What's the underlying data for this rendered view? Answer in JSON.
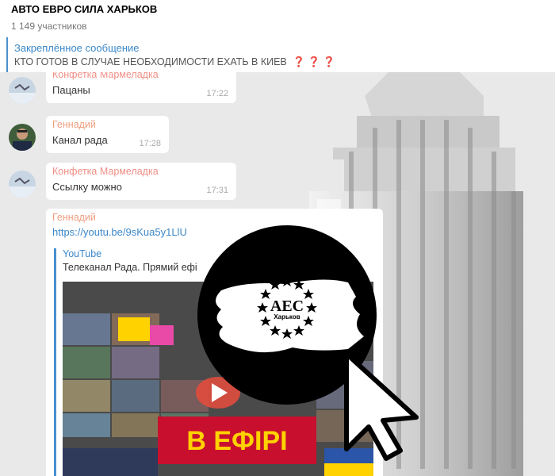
{
  "header": {
    "title": "АВТО ЕВРО СИЛА ХАРЬКОВ",
    "members": "1 149 участников"
  },
  "pinned": {
    "label": "Закреплённое сообщение",
    "text": "КТО ГОТОВ В СЛУЧАЕ НЕОБХОДИМОСТИ  ЕХАТЬ В КИЕВ",
    "marks": "❓ ❓ ❓"
  },
  "messages": [
    {
      "author": "Конфетка Мармеладка",
      "text": "Пацаны",
      "time": "17:22"
    },
    {
      "author": "Геннадий",
      "text": "Канал рада",
      "time": "17:28"
    },
    {
      "author": "Конфетка Мармеладка",
      "text": "Ссылку можно",
      "time": "17:31"
    },
    {
      "author": "Геннадий",
      "link": "https://youtu.be/9sKua5y1LlU",
      "preview_site": "YouTube",
      "preview_title": "Телеканал Рада. Прямий ефі",
      "preview_banner": "В ЕФІРІ"
    }
  ],
  "logo": {
    "text": "AEC",
    "subtext": "Харьков"
  },
  "colors": {
    "accent": "#3a87c9",
    "author_pink": "#f08f85",
    "chat_bg": "#e9e9e9",
    "banner_red": "#c8102e"
  }
}
